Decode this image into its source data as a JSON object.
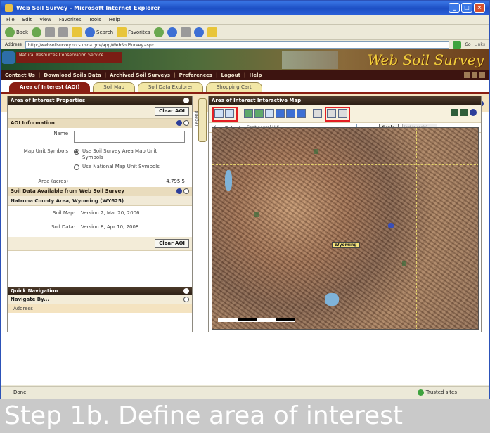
{
  "window": {
    "title": "Web Soil Survey - Microsoft Internet Explorer",
    "controls": [
      "_",
      "□",
      "×"
    ]
  },
  "menu": [
    "File",
    "Edit",
    "View",
    "Favorites",
    "Tools",
    "Help"
  ],
  "toolbar": {
    "back": "Back",
    "search": "Search",
    "favorites": "Favorites"
  },
  "address": {
    "label": "Address",
    "url": "http://websoilsurvey.nrcs.usda.gov/app/WebSoilSurvey.aspx",
    "go": "Go",
    "links": "Links"
  },
  "banner": {
    "agency": "Natural Resources Conservation Service",
    "brand": "Web Soil Survey"
  },
  "site_nav": [
    "Contact Us",
    "Download Soils Data",
    "Archived Soil Surveys",
    "Preferences",
    "Logout",
    "Help"
  ],
  "tabs": [
    {
      "label": "Area of Interest (AOI)",
      "active": true
    },
    {
      "label": "Soil Map",
      "active": false
    },
    {
      "label": "Soil Data Explorer",
      "active": false
    },
    {
      "label": "Shopping Cart",
      "active": false
    }
  ],
  "aoi_properties": {
    "title": "Area of Interest Properties",
    "clear_label": "Clear AOI",
    "info_title": "AOI Information",
    "name_label": "Name",
    "name_value": "",
    "map_unit_label": "Map Unit Symbols",
    "radio_survey": "Use Soil Survey Area Map Unit Symbols",
    "radio_national": "Use National Map Unit Symbols",
    "selected_option": "survey",
    "area_label": "Area (acres)",
    "area_value": "4,795.5",
    "available_title": "Soil Data Available from Web Soil Survey",
    "survey_area": "Natrona County Area, Wyoming (WY625)",
    "soil_map_label": "Soil Map:",
    "soil_map_value": "Version 2, Mar 20, 2006",
    "soil_data_label": "Soil Data:",
    "soil_data_value": "Version 8, Apr 10, 2008",
    "clear_label_2": "Clear AOI"
  },
  "quick_nav": {
    "title": "Quick Navigation",
    "navigate_label": "Navigate By...",
    "address_label": "Address"
  },
  "legend_label": "Legend",
  "map_panel": {
    "title": "Area of Interest Interactive Map",
    "view_extent_label": "View Extent",
    "view_extent_value": "Continental U.S.",
    "scale_label": "Scale",
    "scale_value": "(not to scale)",
    "place_label": "Wyoming"
  },
  "status": {
    "left": "Done",
    "zone": "Trusted sites"
  },
  "caption": "Step 1b. Define area of interest",
  "colors": {
    "tab_active": "#8a1e13",
    "highlight": "#e31e24",
    "caption_bg": "#c9c9c9"
  }
}
